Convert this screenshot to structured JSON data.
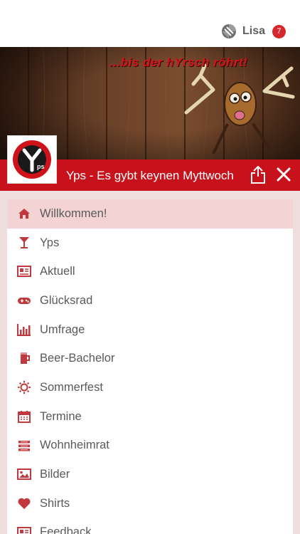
{
  "header": {
    "user_name": "Lisa",
    "notification_count": "7"
  },
  "banner": {
    "slogan": "...bis der hYrsch röhrt!"
  },
  "titlebar": {
    "title": "Yps - Es gybt keynen Myttwoch",
    "logo_text": "ps"
  },
  "menu": {
    "items": [
      {
        "label": "Willkommen!",
        "icon": "home-icon",
        "active": true
      },
      {
        "label": "Yps",
        "icon": "cocktail-icon",
        "active": false
      },
      {
        "label": "Aktuell",
        "icon": "newspaper-icon",
        "active": false
      },
      {
        "label": "Glücksrad",
        "icon": "gamepad-icon",
        "active": false
      },
      {
        "label": "Umfrage",
        "icon": "bar-chart-icon",
        "active": false
      },
      {
        "label": "Beer-Bachelor",
        "icon": "beer-icon",
        "active": false
      },
      {
        "label": "Sommerfest",
        "icon": "sun-icon",
        "active": false
      },
      {
        "label": "Termine",
        "icon": "calendar-icon",
        "active": false
      },
      {
        "label": "Wohnheimrat",
        "icon": "list-icon",
        "active": false
      },
      {
        "label": "Bilder",
        "icon": "image-icon",
        "active": false
      },
      {
        "label": "Shirts",
        "icon": "heart-icon",
        "active": false
      },
      {
        "label": "Feedback",
        "icon": "newspaper-icon",
        "active": false
      }
    ]
  },
  "colors": {
    "brand_red": "#c8121b",
    "icon_red": "#c0393e",
    "active_bg": "#f3d3d3",
    "content_bg": "#efdede"
  }
}
